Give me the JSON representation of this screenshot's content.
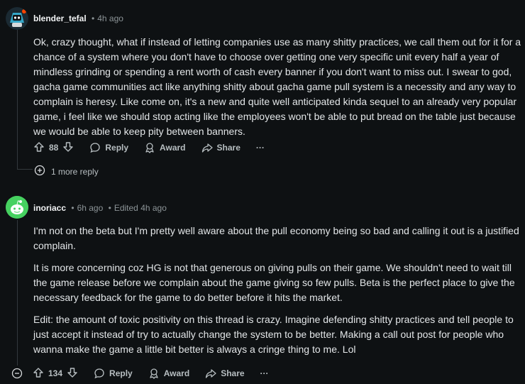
{
  "comments": [
    {
      "author": "blender_tefal",
      "separator": "•",
      "time": "4h ago",
      "body": "Ok, crazy thought, what if instead of letting companies use as many shitty practices, we call them out for it for a chance of a system where you don't have to choose over getting one very specific unit every half a year of mindless grinding or spending a rent worth of cash every banner if you don't want to miss out. I swear to god, gacha game communities act like anything shitty about gacha game pull system is a necessity and any way to complain is heresy. Like come on, it's a new and quite well anticipated kinda sequel to an already very popular game, i feel like we should stop acting like the employees won't be able to put bread on the table just because we would be able to keep pity between banners.",
      "votes": "88",
      "reply_label": "Reply",
      "award_label": "Award",
      "share_label": "Share",
      "more_label": "···",
      "more_replies": "1 more reply"
    },
    {
      "author": "inoriacc",
      "separator": "•",
      "time": "6h ago",
      "edited": "Edited 4h ago",
      "paragraphs": [
        "I'm not on the beta but I'm pretty well aware about the pull economy being so bad and calling it out is a justified complain.",
        "It is more concerning coz  HG is not that generous on giving pulls on their game. We shouldn't  need to wait till the game release before we complain about the game giving so few pulls. Beta is the perfect place to give the necessary feedback for the game to do better before it hits the market.",
        "Edit: the amount of toxic positivity on this thread is crazy. Imagine defending shitty practices and tell people to just accept it instead of try to actually change the system to be better. Making a call out post for  people who wanna make the game a little bit better is always a cringe thing to me. Lol"
      ],
      "votes": "134",
      "reply_label": "Reply",
      "award_label": "Award",
      "share_label": "Share",
      "more_label": "···"
    }
  ],
  "colors": {
    "background": "#0e1113",
    "text": "#e3e6e8",
    "muted": "#8c9497",
    "avatar2": "#46d160"
  }
}
